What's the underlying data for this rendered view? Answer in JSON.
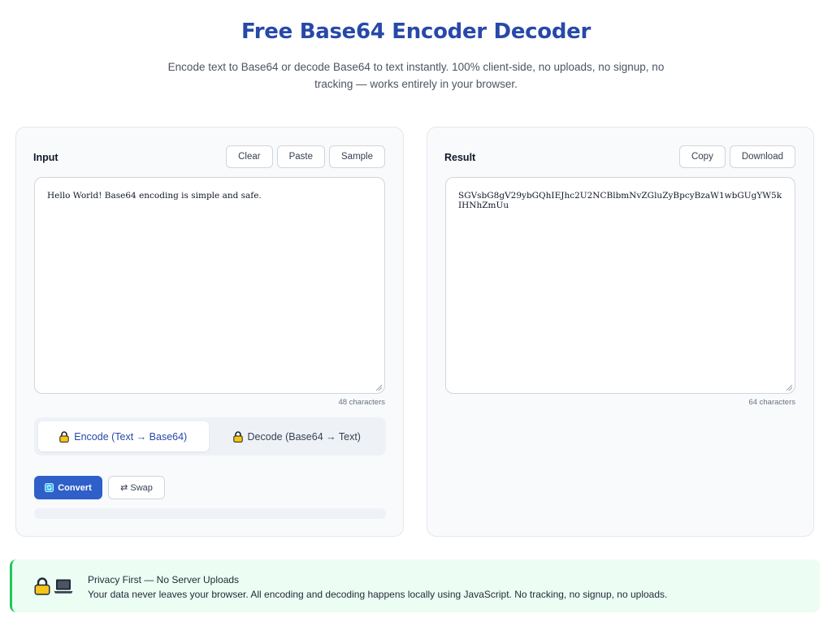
{
  "header": {
    "title": "Free Base64 Encoder Decoder",
    "subtitle": "Encode text to Base64 or decode Base64 to text instantly. 100% client-side, no uploads, no signup, no tracking — works entirely in your browser."
  },
  "input_panel": {
    "label": "Input",
    "buttons": {
      "clear": "Clear",
      "paste": "Paste",
      "sample": "Sample"
    },
    "value": "Hello World! Base64 encoding is simple and safe.",
    "char_count": "48 characters"
  },
  "mode_tabs": {
    "encode": "Encode (Text → Base64)",
    "decode": "Decode (Base64 → Text)",
    "active": "encode"
  },
  "actions": {
    "convert": "Convert",
    "swap": "⇄ Swap"
  },
  "result_panel": {
    "label": "Result",
    "buttons": {
      "copy": "Copy",
      "download": "Download"
    },
    "value": "SGVsbG8gV29ybGQhIEJhc2U2NCBlbmNvZGluZyBpcyBzaW1wbGUgYW5kIHNhZmUu",
    "char_count": "64 characters"
  },
  "notice": {
    "title": "Privacy First — No Server Uploads",
    "text": "Your data never leaves your browser. All encoding and decoding happens locally using JavaScript. No tracking, no signup, no uploads."
  },
  "colors": {
    "accent": "#2f5fc8",
    "title": "#2749a8",
    "notice_bg": "#ecfdf3",
    "notice_border": "#22c55e",
    "lock": "#f5c518"
  },
  "icons": [
    "lock-icon",
    "laptop-icon",
    "convert-icon",
    "resize-grip-icon"
  ]
}
